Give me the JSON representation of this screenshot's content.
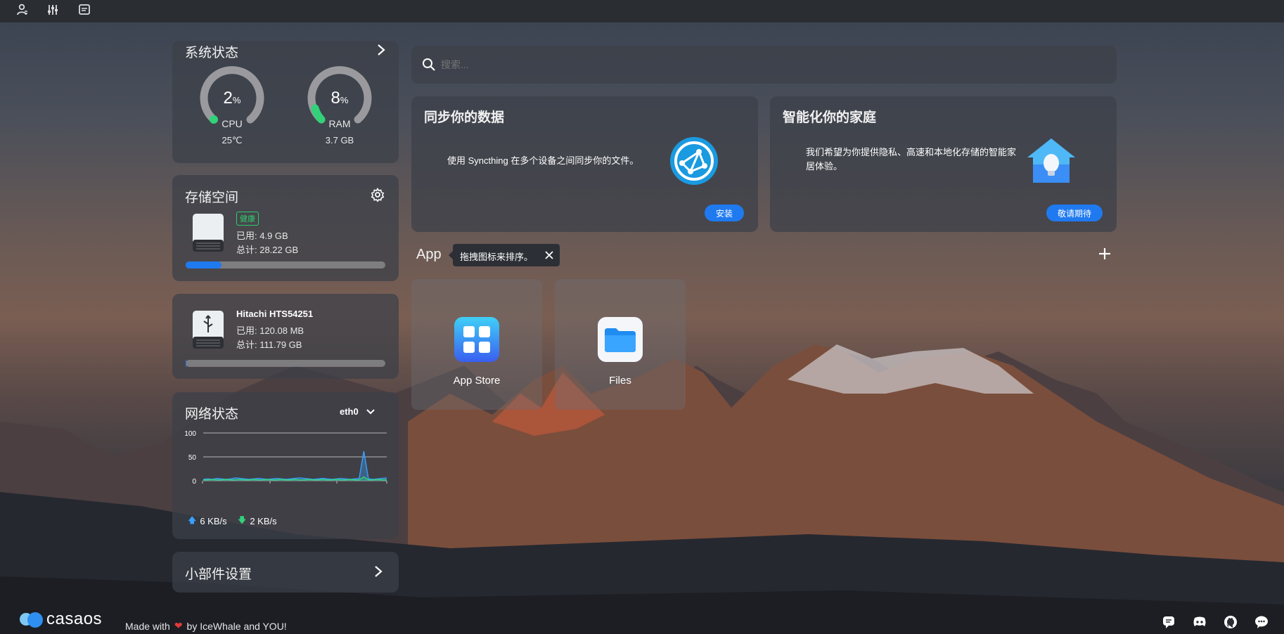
{
  "system": {
    "title": "系统状态",
    "cpu": {
      "value": "2",
      "unit": "%",
      "label": "CPU",
      "sub": "25℃",
      "percent": 2
    },
    "ram": {
      "value": "8",
      "unit": "%",
      "label": "RAM",
      "sub": "3.7 GB",
      "percent": 8
    }
  },
  "storage": {
    "title": "存储空间",
    "badge": "健康",
    "used": "已用: 4.9 GB",
    "total": "总计: 28.22 GB",
    "fill_fraction": 0.18
  },
  "disk2": {
    "name": "Hitachi HTS54251",
    "used": "已用: 120.08 MB",
    "total": "总计: 111.79 GB",
    "fill_fraction": 0.001
  },
  "network": {
    "title": "网络状态",
    "interface": "eth0",
    "upload": "6 KB/s",
    "download": "2 KB/s",
    "y_ticks": [
      "100",
      "50",
      "0"
    ]
  },
  "widget_settings": {
    "label": "小部件设置"
  },
  "search": {
    "placeholder": "搜索..."
  },
  "promo1": {
    "title": "同步你的数据",
    "text": "使用 Syncthing 在多个设备之间同步你的文件。",
    "button": "安装"
  },
  "promo2": {
    "title": "智能化你的家庭",
    "text": "我们希望为你提供隐私、高速和本地化存储的智能家居体验。",
    "button": "敬请期待"
  },
  "apps": {
    "heading": "App",
    "tooltip": "拖拽图标来排序。",
    "items": [
      {
        "label": "App Store"
      },
      {
        "label": "Files"
      }
    ]
  },
  "footer": {
    "brand": "casaos",
    "made_with": "Made with",
    "by": "by IceWhale and YOU!"
  },
  "colors": {
    "accent": "#1f7af0",
    "gauge_green": "#33d17a",
    "health_green": "#2ecc71"
  },
  "chart_data": {
    "type": "line",
    "title": "",
    "ylim": [
      0,
      100
    ],
    "y_ticks": [
      0,
      50,
      100
    ],
    "series": [
      {
        "name": "upload",
        "values": [
          3,
          4,
          3,
          5,
          4,
          3,
          4,
          6,
          5,
          4,
          3,
          4,
          5,
          4,
          3,
          4,
          5,
          4,
          3,
          4,
          5,
          6,
          5,
          4,
          3,
          4,
          5,
          4,
          3,
          4,
          5,
          4,
          3,
          4,
          5,
          62,
          4,
          3,
          4,
          5,
          6
        ]
      },
      {
        "name": "download",
        "values": [
          2,
          2,
          3,
          2,
          2,
          3,
          2,
          2,
          3,
          2,
          2,
          3,
          2,
          2,
          3,
          2,
          2,
          3,
          2,
          2,
          3,
          2,
          2,
          3,
          2,
          2,
          3,
          2,
          2,
          3,
          2,
          2,
          3,
          2,
          2,
          8,
          2,
          2,
          3,
          2,
          2
        ]
      }
    ]
  }
}
